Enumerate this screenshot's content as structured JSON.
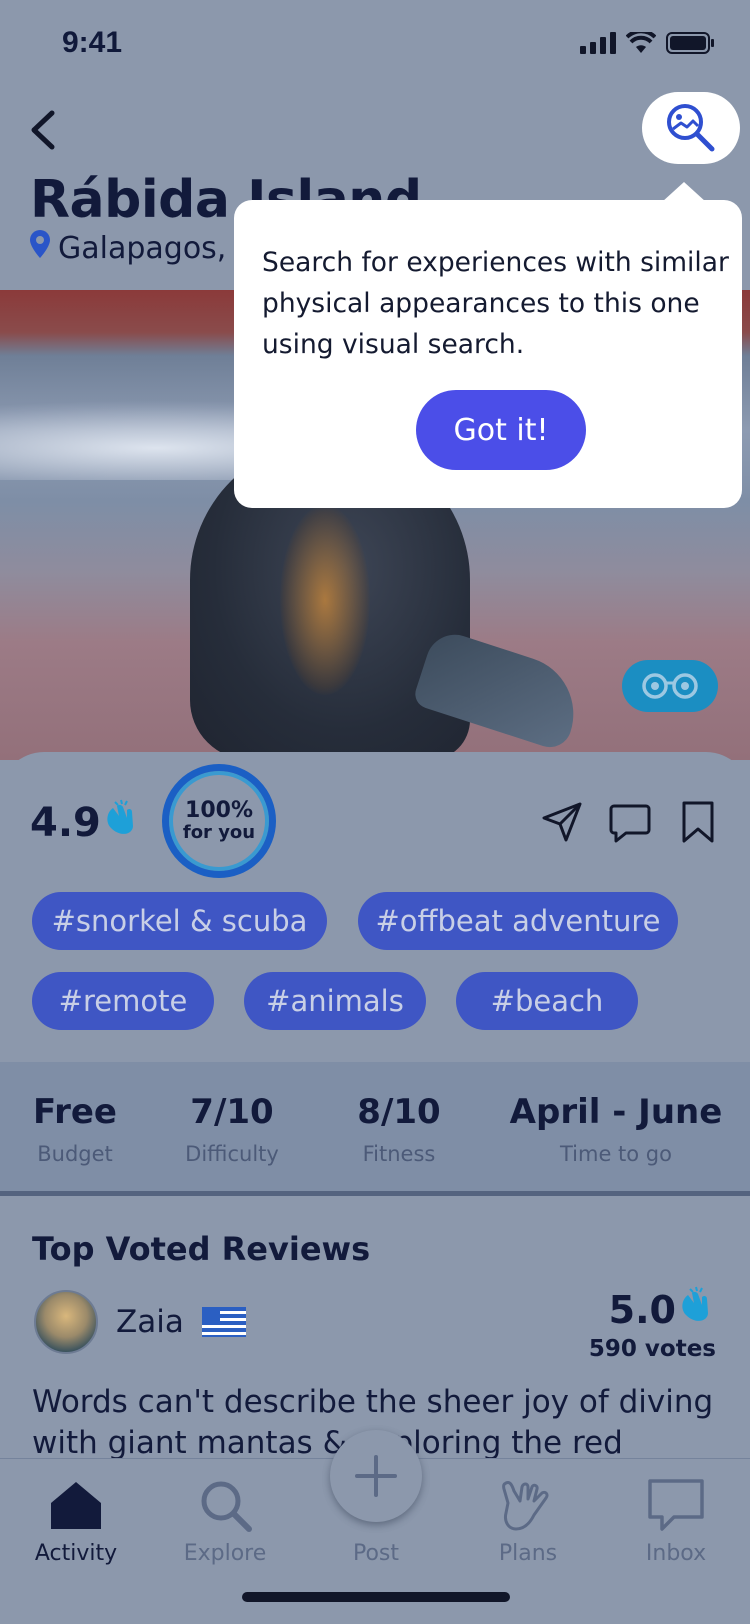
{
  "status": {
    "time": "9:41"
  },
  "header": {
    "title": "Rábida Island",
    "location": "Galapagos,"
  },
  "tooltip": {
    "text": "Search for experiences with similar physical appearances to this one using visual search.",
    "button": "Got it!"
  },
  "summary": {
    "rating": "4.9",
    "match_pct": "100%",
    "match_label": "for you"
  },
  "tags": [
    "#snorkel & scuba",
    "#offbeat adventure",
    "#remote",
    "#animals",
    "#beach"
  ],
  "stats": [
    {
      "value": "Free",
      "label": "Budget"
    },
    {
      "value": "7/10",
      "label": "Difficulty"
    },
    {
      "value": "8/10",
      "label": "Fitness"
    },
    {
      "value": "April - June",
      "label": "Time to go"
    }
  ],
  "reviews": {
    "title": "Top Voted Reviews",
    "reviewer": "Zaia",
    "score": "5.0",
    "votes": "590 votes",
    "text": "Words can't describe the sheer joy of diving with giant mantas & exploring the red"
  },
  "tabbar": {
    "items": [
      {
        "label": "Activity",
        "icon": "home-icon"
      },
      {
        "label": "Explore",
        "icon": "search-icon"
      },
      {
        "label": "Post",
        "icon": "plus-icon"
      },
      {
        "label": "Plans",
        "icon": "hand-icon"
      },
      {
        "label": "Inbox",
        "icon": "chat-icon"
      }
    ]
  },
  "colors": {
    "accent": "#4b4ee8",
    "tag": "#3f56c4",
    "text": "#121a3b",
    "clap": "#1ea0d8"
  }
}
